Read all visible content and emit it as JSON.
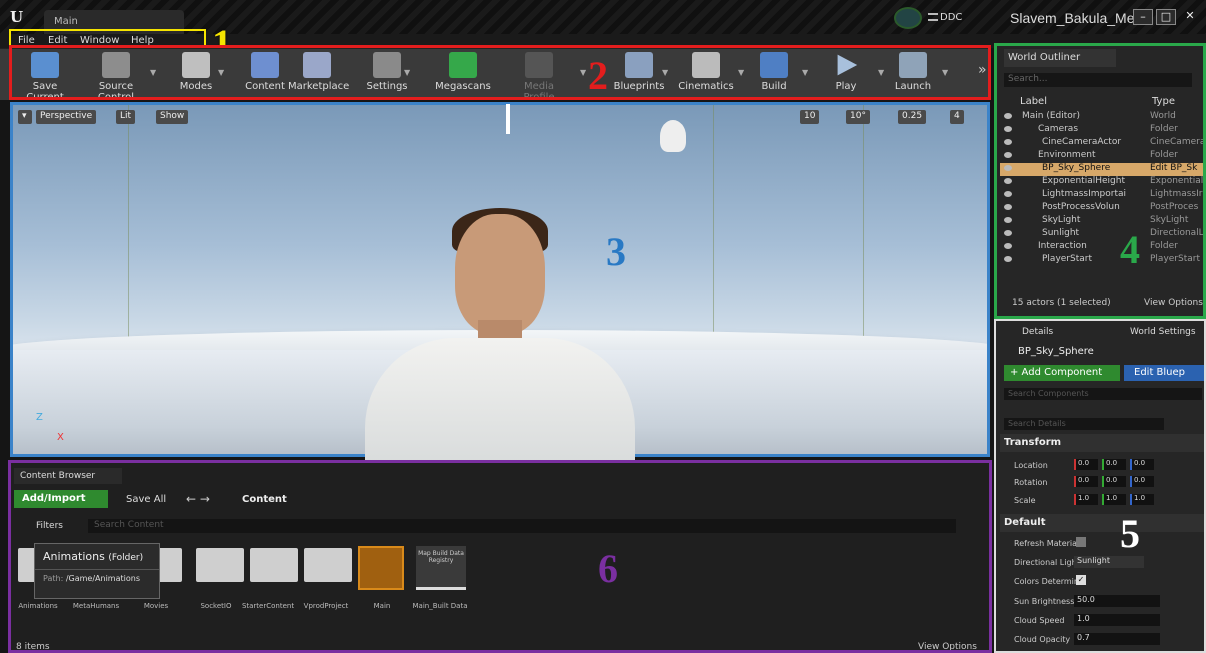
{
  "titlebar": {
    "logo": "U",
    "map_tab": "Main",
    "ddc_label": "DDC",
    "project": "Slavem_Bakula_Meta",
    "min": "–",
    "max": "□",
    "close": "✕"
  },
  "menu": [
    "File",
    "Edit",
    "Window",
    "Help"
  ],
  "toolbar": [
    {
      "label": "Save Current"
    },
    {
      "label": "Source Control"
    },
    {
      "label": "Modes"
    },
    {
      "label": "Content"
    },
    {
      "label": "Marketplace"
    },
    {
      "label": "Settings"
    },
    {
      "label": "Megascans"
    },
    {
      "label": "Media Profile"
    },
    {
      "label": "Blueprints"
    },
    {
      "label": "Cinematics"
    },
    {
      "label": "Build"
    },
    {
      "label": "Play"
    },
    {
      "label": "Launch"
    }
  ],
  "annotations": [
    "1",
    "2",
    "3",
    "4",
    "5",
    "6"
  ],
  "viewport": {
    "perspective": "Perspective",
    "lit": "Lit",
    "show": "Show",
    "grid_snap": "10",
    "rot_snap": "10°",
    "scale_snap": "0.25",
    "cam_speed": "4",
    "axis_z": "Z",
    "axis_x": "X"
  },
  "outliner": {
    "tab": "World Outliner",
    "search_placeholder": "Search...",
    "col_label": "Label",
    "col_type": "Type",
    "rows": [
      {
        "label": "Main (Editor)",
        "type": "World"
      },
      {
        "label": "Cameras",
        "type": "Folder"
      },
      {
        "label": "CineCameraActor",
        "type": "CineCamera"
      },
      {
        "label": "Environment",
        "type": "Folder"
      },
      {
        "label": "BP_Sky_Sphere",
        "type": "Edit BP_Sk"
      },
      {
        "label": "ExponentialHeight",
        "type": "Exponential"
      },
      {
        "label": "LightmassImportai",
        "type": "LightmassIr"
      },
      {
        "label": "PostProcessVolun",
        "type": "PostProces"
      },
      {
        "label": "SkyLight",
        "type": "SkyLight"
      },
      {
        "label": "Sunlight",
        "type": "DirectionalL"
      },
      {
        "label": "Interaction",
        "type": "Folder"
      },
      {
        "label": "PlayerStart",
        "type": "PlayerStart"
      }
    ],
    "status": "15 actors (1 selected)",
    "view_options": "View Options"
  },
  "details": {
    "tab": "Details",
    "tab2": "World Settings",
    "actor_name": "BP_Sky_Sphere",
    "add_component": "+ Add Component",
    "edit_bp": "Edit Bluep",
    "search_components": "Search Components",
    "search_details": "Search Details",
    "transform": "Transform",
    "location": "Location",
    "rotation": "Rotation",
    "scale": "Scale",
    "loc": [
      "0.0",
      "0.0",
      "0.0"
    ],
    "rot": [
      "0.0",
      "0.0",
      "0.0"
    ],
    "scl": [
      "1.0",
      "1.0",
      "1.0"
    ],
    "default": "Default",
    "props": [
      {
        "label": "Refresh Materia",
        "value": ""
      },
      {
        "label": "Directional Light",
        "value": "Sunlight"
      },
      {
        "label": "Colors Determin",
        "value": ""
      },
      {
        "label": "Sun Brightness",
        "value": "50.0"
      },
      {
        "label": "Cloud Speed",
        "value": "1.0"
      },
      {
        "label": "Cloud Opacity",
        "value": "0.7"
      }
    ]
  },
  "content_browser": {
    "tab": "Content Browser",
    "add_import": "Add/Import",
    "save_all": "Save All",
    "path": "Content",
    "filters": "Filters",
    "search_placeholder": "Search Content",
    "tooltip_title": "Animations",
    "tooltip_kind": "(Folder)",
    "tooltip_path_label": "Path:",
    "tooltip_path": "/Game/Animations",
    "items": [
      "Animations",
      "MetaHumans",
      "Movies",
      "SocketIO",
      "StarterContent",
      "VprodProject",
      "Main",
      "Main_Built Data"
    ],
    "map_build_label": "Map Build Data Registry",
    "count": "8 items",
    "view_options": "View Options"
  }
}
